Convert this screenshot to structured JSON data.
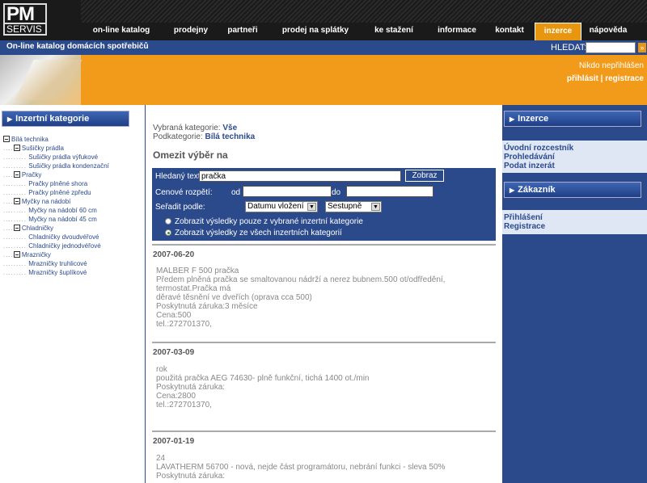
{
  "logo": {
    "line1": "PM",
    "line2": "SERVIS"
  },
  "nav": [
    {
      "label": "on-line katalog",
      "active": false
    },
    {
      "label": "prodejny",
      "active": false
    },
    {
      "label": "partneři",
      "active": false
    },
    {
      "label": "prodej na splátky",
      "active": false
    },
    {
      "label": "ke stažení",
      "active": false
    },
    {
      "label": "informace",
      "active": false
    },
    {
      "label": "kontakt",
      "active": false
    },
    {
      "label": "inzerce",
      "active": true
    },
    {
      "label": "nápověda",
      "active": false
    }
  ],
  "subheader": {
    "title": "On-line katalog domácích spotřebičů",
    "search_label": "HLEDAT:",
    "search_value": "",
    "search_button": "»"
  },
  "login": {
    "note": "Nikdo nepřihlášen",
    "login_link": "přihlásit",
    "separator": "|",
    "register_link": "registrace"
  },
  "left_panel": {
    "title": "Inzertní kategorie",
    "tree": [
      {
        "label": "Bílá technika",
        "level": 0
      },
      {
        "label": "Sušičky prádla",
        "level": 1
      },
      {
        "label": "Sušičky prádla výfukové",
        "level": 2
      },
      {
        "label": "Sušičky prádla kondenzační",
        "level": 2
      },
      {
        "label": "Pračky",
        "level": 1
      },
      {
        "label": "Pračky plněné shora",
        "level": 2
      },
      {
        "label": "Pračky plněné zpředu",
        "level": 2
      },
      {
        "label": "Myčky na nádobí",
        "level": 1
      },
      {
        "label": "Myčky na nádobí 60 cm",
        "level": 2
      },
      {
        "label": "Myčky na nádobí 45 cm",
        "level": 2
      },
      {
        "label": "Chladničky",
        "level": 1
      },
      {
        "label": "Chladničky dvoudvéřové",
        "level": 2
      },
      {
        "label": "Chladničky jednodvéřové",
        "level": 2
      },
      {
        "label": "Mrazničky",
        "level": 1
      },
      {
        "label": "Mrazničky truhlicové",
        "level": 2
      },
      {
        "label": "Mrazničky šuplíkové",
        "level": 2
      }
    ]
  },
  "center": {
    "selected_category_label": "Vybraná kategorie:",
    "selected_category_value": "Vše",
    "subcategory_label": "Podkategorie:",
    "subcategory_value": "Bílá technika",
    "filter_title": "Omezit výběr na",
    "filter": {
      "search_label": "Hledaný text:",
      "search_value": "pračka",
      "search_button": "Zobraz",
      "price_label": "Cenové rozpětí:",
      "price_from_label": "od",
      "price_from_value": "",
      "price_to_label": "do",
      "price_to_value": "",
      "sort_label": "Seřadit podle:",
      "sort_by_value": "Datumu vložení",
      "sort_order_value": "Sestupně",
      "radio_1": "Zobrazit výsledky pouze z vybrané inzertní kategorie",
      "radio_2": "Zobrazit výsledky ze všech inzertních kategorií",
      "selected_radio": 2
    },
    "results": [
      {
        "date": "2007-06-20",
        "lines": [
          "MALBER F 500 pračka",
          "Předem plněná pračka se smaltovanou nádrží a nerez bubnem.500 ot/odfředění, termostat.Pračka má",
          "děravé těsnění ve dveřích (oprava cca 500)",
          "Poskytnutá záruka:3 měsíce",
          "Cena:500",
          "tel.:272701370,"
        ]
      },
      {
        "date": "2007-03-09",
        "lines": [
          "rok",
          "použitá pračka AEG 74630- plně funkční, tichá 1400 ot./min",
          "Poskytnutá záruka:",
          "Cena:2800",
          "tel.:272701370,"
        ]
      },
      {
        "date": "2007-01-19",
        "lines": [
          "24",
          "LAVATHERM 56700 - nová, nejde část programátoru, nebrání funkci - sleva 50%",
          "Poskytnutá záruka:"
        ]
      }
    ]
  },
  "right_panel": {
    "inzerce_title": "Inzerce",
    "inzerce_links": [
      "Úvodní rozcestník",
      "Prohledávání",
      "Podat inzerát"
    ],
    "zakaznik_title": "Zákazník",
    "zakaznik_links": [
      "Přihlášení",
      "Registrace"
    ]
  },
  "colors": {
    "primary_blue": "#2b4a8c",
    "accent_orange": "#f29a19",
    "header_dark": "#1a1a1a"
  }
}
